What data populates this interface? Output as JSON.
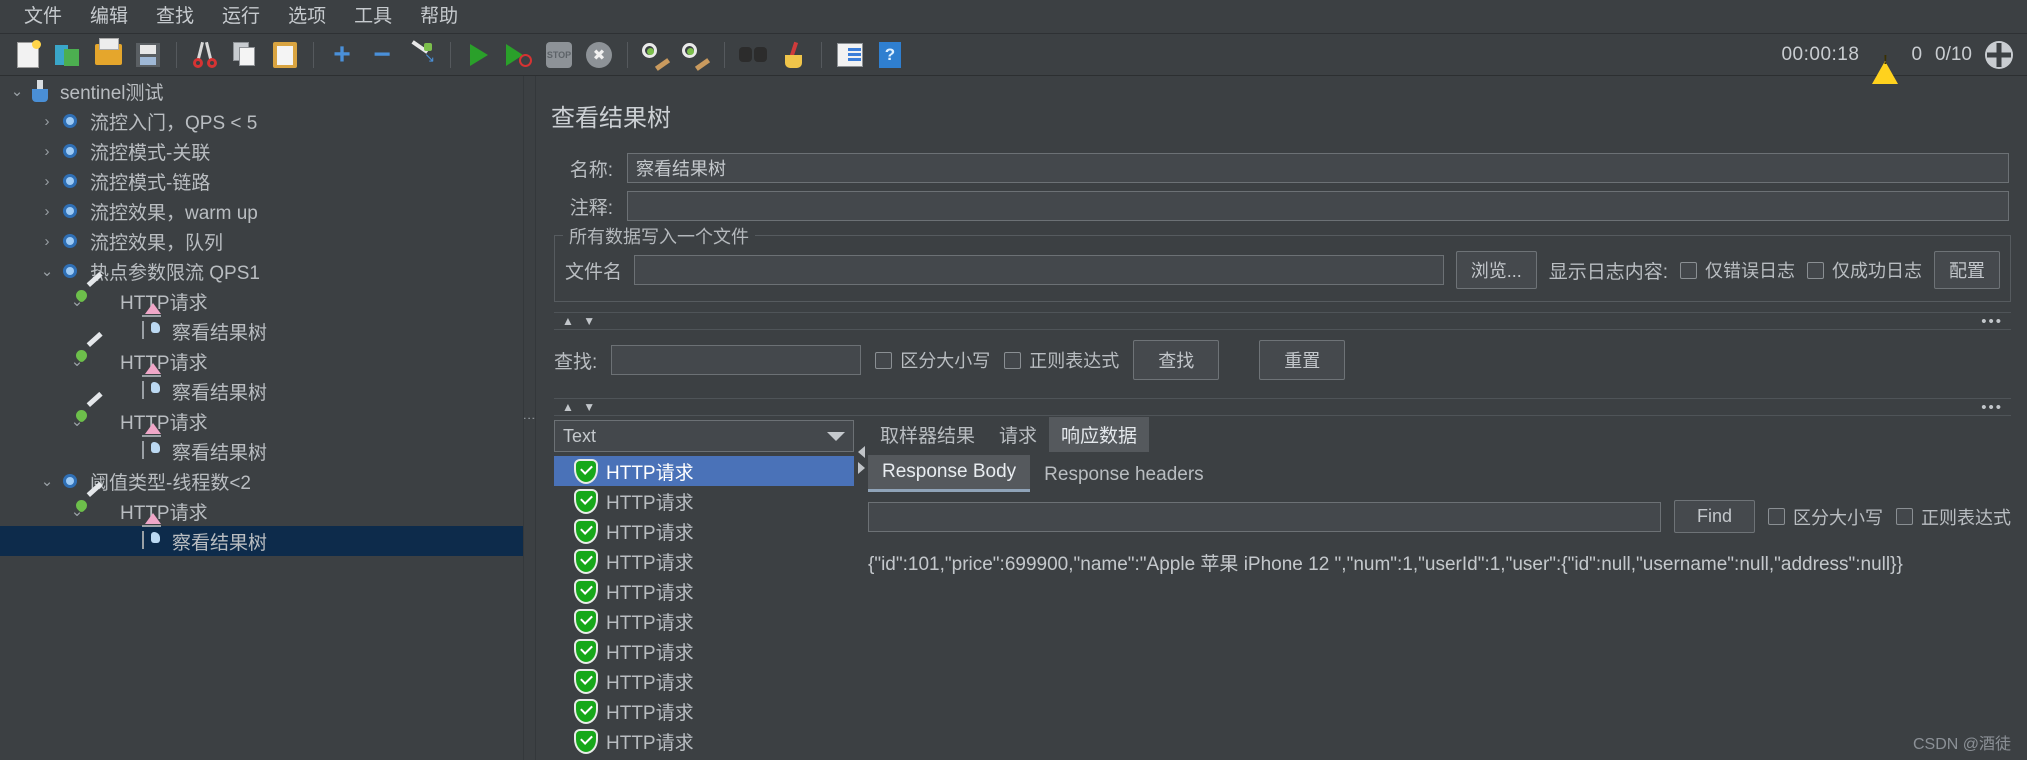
{
  "menubar": {
    "items": [
      {
        "label": "文件",
        "name": "menu-file"
      },
      {
        "label": "编辑",
        "name": "menu-edit"
      },
      {
        "label": "查找",
        "name": "menu-search"
      },
      {
        "label": "运行",
        "name": "menu-run"
      },
      {
        "label": "选项",
        "name": "menu-options"
      },
      {
        "label": "工具",
        "name": "menu-tools"
      },
      {
        "label": "帮助",
        "name": "menu-help"
      }
    ]
  },
  "toolbar": {
    "icons": [
      "new-document-icon",
      "templates-icon",
      "open-file-icon",
      "save-icon",
      "cut-icon",
      "copy-icon",
      "paste-icon",
      "expand-all-icon",
      "collapse-all-icon",
      "toggle-icon",
      "start-icon",
      "start-no-pauses-icon",
      "stop-icon",
      "shutdown-icon",
      "clear-icon",
      "clear-all-icon",
      "search-icon",
      "search-reset-icon",
      "function-helper-icon",
      "help-icon"
    ],
    "timer": "00:00:18",
    "error_count": "0",
    "thread_count": "0/10",
    "warning_icon": "warning-triangle-icon",
    "connection_icon": "globe-icon"
  },
  "tree": {
    "rows": [
      {
        "label": "sentinel测试",
        "icon": "flask-icon",
        "indent": 0,
        "twisty": "open",
        "selected": false
      },
      {
        "label": "流控入门，QPS < 5",
        "icon": "gear-icon",
        "indent": 1,
        "twisty": "closed",
        "selected": false
      },
      {
        "label": "流控模式-关联",
        "icon": "gear-icon",
        "indent": 1,
        "twisty": "closed",
        "selected": false
      },
      {
        "label": "流控模式-链路",
        "icon": "gear-icon",
        "indent": 1,
        "twisty": "closed",
        "selected": false
      },
      {
        "label": "流控效果，warm up",
        "icon": "gear-icon",
        "indent": 1,
        "twisty": "closed",
        "selected": false
      },
      {
        "label": "流控效果，队列",
        "icon": "gear-icon",
        "indent": 1,
        "twisty": "closed",
        "selected": false
      },
      {
        "label": "热点参数限流 QPS1",
        "icon": "gear-icon",
        "indent": 1,
        "twisty": "open",
        "selected": false
      },
      {
        "label": "HTTP请求",
        "icon": "pipette-icon",
        "indent": 2,
        "twisty": "open",
        "selected": false
      },
      {
        "label": "察看结果树",
        "icon": "chart-icon",
        "indent": 3,
        "twisty": "none",
        "selected": false
      },
      {
        "label": "HTTP请求",
        "icon": "pipette-icon",
        "indent": 2,
        "twisty": "open",
        "selected": false
      },
      {
        "label": "察看结果树",
        "icon": "chart-icon",
        "indent": 3,
        "twisty": "none",
        "selected": false
      },
      {
        "label": "HTTP请求",
        "icon": "pipette-icon",
        "indent": 2,
        "twisty": "open",
        "selected": false
      },
      {
        "label": "察看结果树",
        "icon": "chart-icon",
        "indent": 3,
        "twisty": "none",
        "selected": false
      },
      {
        "label": "阈值类型-线程数<2",
        "icon": "gear-icon",
        "indent": 1,
        "twisty": "open",
        "selected": false
      },
      {
        "label": "HTTP请求",
        "icon": "pipette-icon",
        "indent": 2,
        "twisty": "open",
        "selected": false
      },
      {
        "label": "察看结果树",
        "icon": "chart-icon",
        "indent": 3,
        "twisty": "none",
        "selected": true
      }
    ]
  },
  "panel": {
    "title": "查看结果树",
    "name_label": "名称:",
    "name_value": "察看结果树",
    "comment_label": "注释:",
    "comment_value": "",
    "file_group_legend": "所有数据写入一个文件",
    "filename_label": "文件名",
    "filename_value": "",
    "browse_button": "浏览...",
    "log_display_label": "显示日志内容:",
    "error_log_only": "仅错误日志",
    "success_log_only": "仅成功日志",
    "config_button": "配置",
    "search_label": "查找:",
    "search_value": "",
    "case_sensitive": "区分大小写",
    "regex": "正则表达式",
    "search_button": "查找",
    "reset_button": "重置",
    "divider_arrows": "▲ ▼",
    "divider_dots": "•••"
  },
  "results": {
    "renderer_selected": "Text",
    "items": [
      {
        "label": "HTTP请求",
        "status": "success",
        "selected": true
      },
      {
        "label": "HTTP请求",
        "status": "success",
        "selected": false
      },
      {
        "label": "HTTP请求",
        "status": "success",
        "selected": false
      },
      {
        "label": "HTTP请求",
        "status": "success",
        "selected": false
      },
      {
        "label": "HTTP请求",
        "status": "success",
        "selected": false
      },
      {
        "label": "HTTP请求",
        "status": "success",
        "selected": false
      },
      {
        "label": "HTTP请求",
        "status": "success",
        "selected": false
      },
      {
        "label": "HTTP请求",
        "status": "success",
        "selected": false
      },
      {
        "label": "HTTP请求",
        "status": "success",
        "selected": false
      },
      {
        "label": "HTTP请求",
        "status": "success",
        "selected": false
      }
    ],
    "tabs": [
      {
        "label": "取样器结果",
        "active": false
      },
      {
        "label": "请求",
        "active": false
      },
      {
        "label": "响应数据",
        "active": true
      }
    ],
    "subtabs": [
      {
        "label": "Response Body",
        "active": true
      },
      {
        "label": "Response headers",
        "active": false
      }
    ],
    "find_value": "",
    "find_button": "Find",
    "find_case_sensitive": "区分大小写",
    "find_regex": "正则表达式",
    "response_body": "{\"id\":101,\"price\":699900,\"name\":\"Apple 苹果 iPhone 12 \",\"num\":1,\"userId\":1,\"user\":{\"id\":null,\"username\":null,\"address\":null}}"
  },
  "watermark": "CSDN @酒徒",
  "colors": {
    "background": "#3c4043",
    "selection_tree": "#0d2b4b",
    "selection_list": "#4a72b8",
    "accent": "#4a90d9",
    "success": "#17a81a"
  }
}
